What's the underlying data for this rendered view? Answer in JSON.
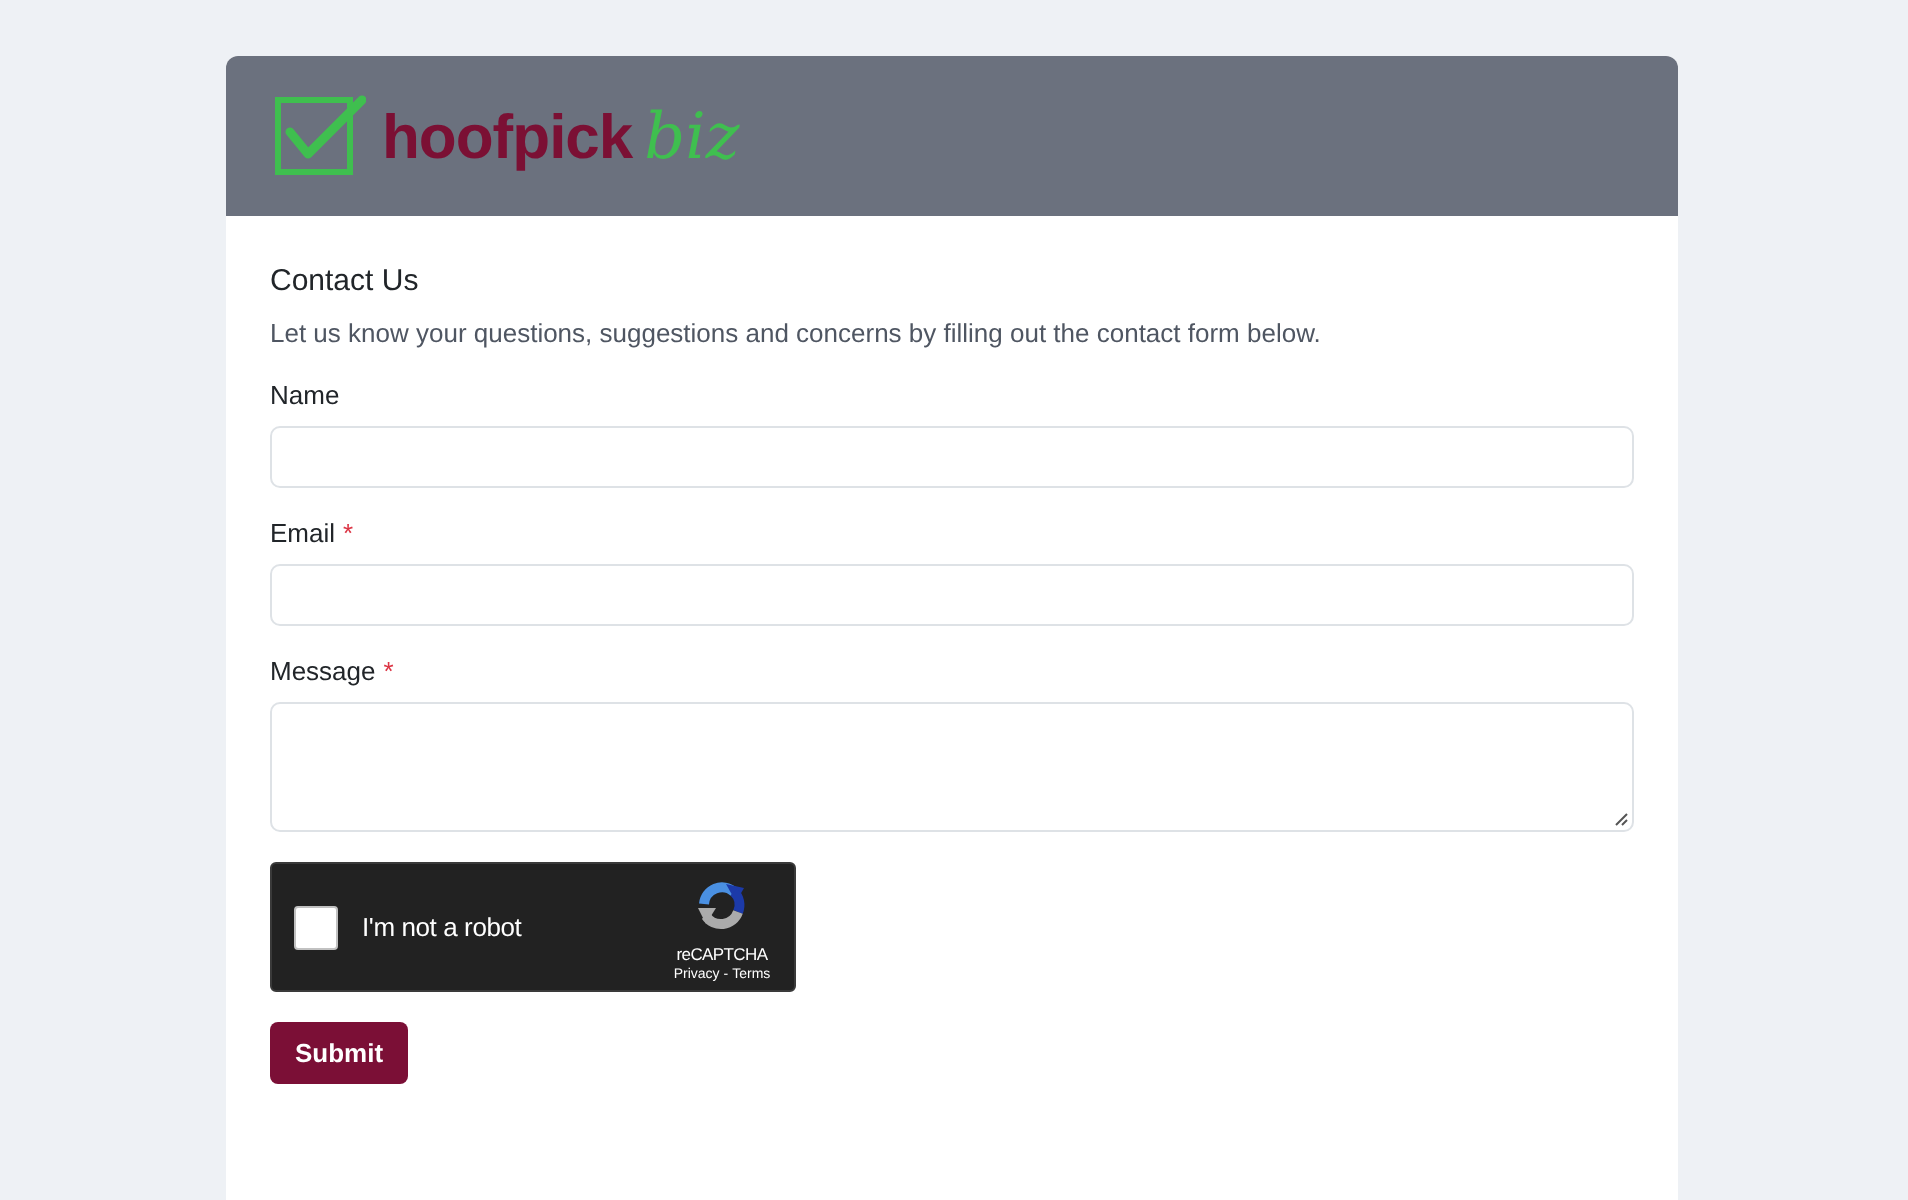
{
  "header": {
    "logo": {
      "brand": "hoofpick",
      "suffix": "biz"
    }
  },
  "form": {
    "title": "Contact Us",
    "description": "Let us know your questions, suggestions and concerns by filling out the contact form below.",
    "required_mark": "*",
    "fields": [
      {
        "label": "Name",
        "required": false,
        "kind": "input"
      },
      {
        "label": "Email",
        "required": true,
        "kind": "input"
      },
      {
        "label": "Message",
        "required": true,
        "kind": "textarea"
      }
    ],
    "captcha": {
      "label": "I'm not a robot",
      "checked": false,
      "brand": "reCAPTCHA",
      "links": [
        "Privacy",
        "Terms"
      ],
      "separator": "-"
    },
    "submit": "Submit"
  }
}
